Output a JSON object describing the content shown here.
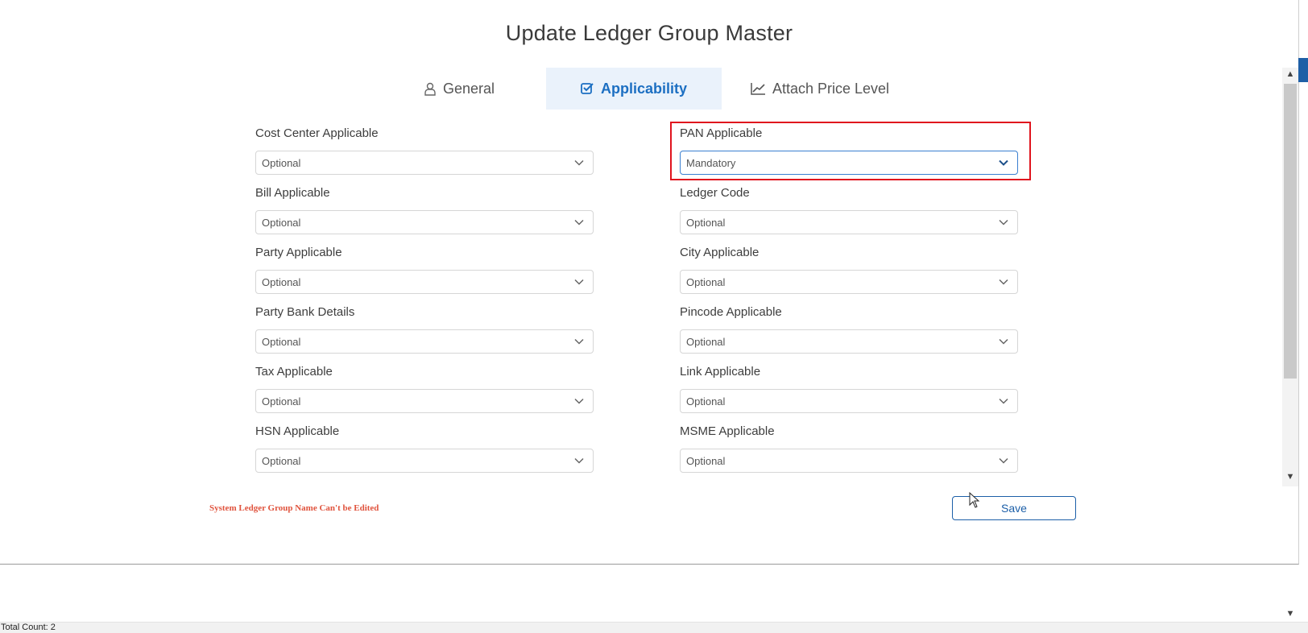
{
  "dialog": {
    "title": "Update Ledger Group Master"
  },
  "tabs": [
    {
      "label": "General",
      "icon": "user-icon",
      "active": false
    },
    {
      "label": "Applicability",
      "icon": "checkbox-icon",
      "active": true
    },
    {
      "label": "Attach Price Level",
      "icon": "line-chart-icon",
      "active": false
    }
  ],
  "fields": {
    "cost_center": {
      "label": "Cost Center Applicable",
      "value": "Optional"
    },
    "bill": {
      "label": "Bill Applicable",
      "value": "Optional"
    },
    "party": {
      "label": "Party Applicable",
      "value": "Optional"
    },
    "party_bank": {
      "label": "Party Bank Details",
      "value": "Optional"
    },
    "tax": {
      "label": "Tax Applicable",
      "value": "Optional"
    },
    "hsn": {
      "label": "HSN Applicable",
      "value": "Optional"
    },
    "pan": {
      "label": "PAN Applicable",
      "value": "Mandatory"
    },
    "ledger_code": {
      "label": "Ledger Code",
      "value": "Optional"
    },
    "city": {
      "label": "City Applicable",
      "value": "Optional"
    },
    "pincode": {
      "label": "Pincode Applicable",
      "value": "Optional"
    },
    "link": {
      "label": "Link Applicable",
      "value": "Optional"
    },
    "msme": {
      "label": "MSME Applicable",
      "value": "Optional"
    }
  },
  "note": "System Ledger Group Name Can't be Edited",
  "save_label": "Save",
  "footer": {
    "total_count": "Total Count: 2"
  },
  "colors": {
    "accent": "#1c6fc2",
    "highlight": "#e0141e",
    "note": "#e0533d"
  }
}
